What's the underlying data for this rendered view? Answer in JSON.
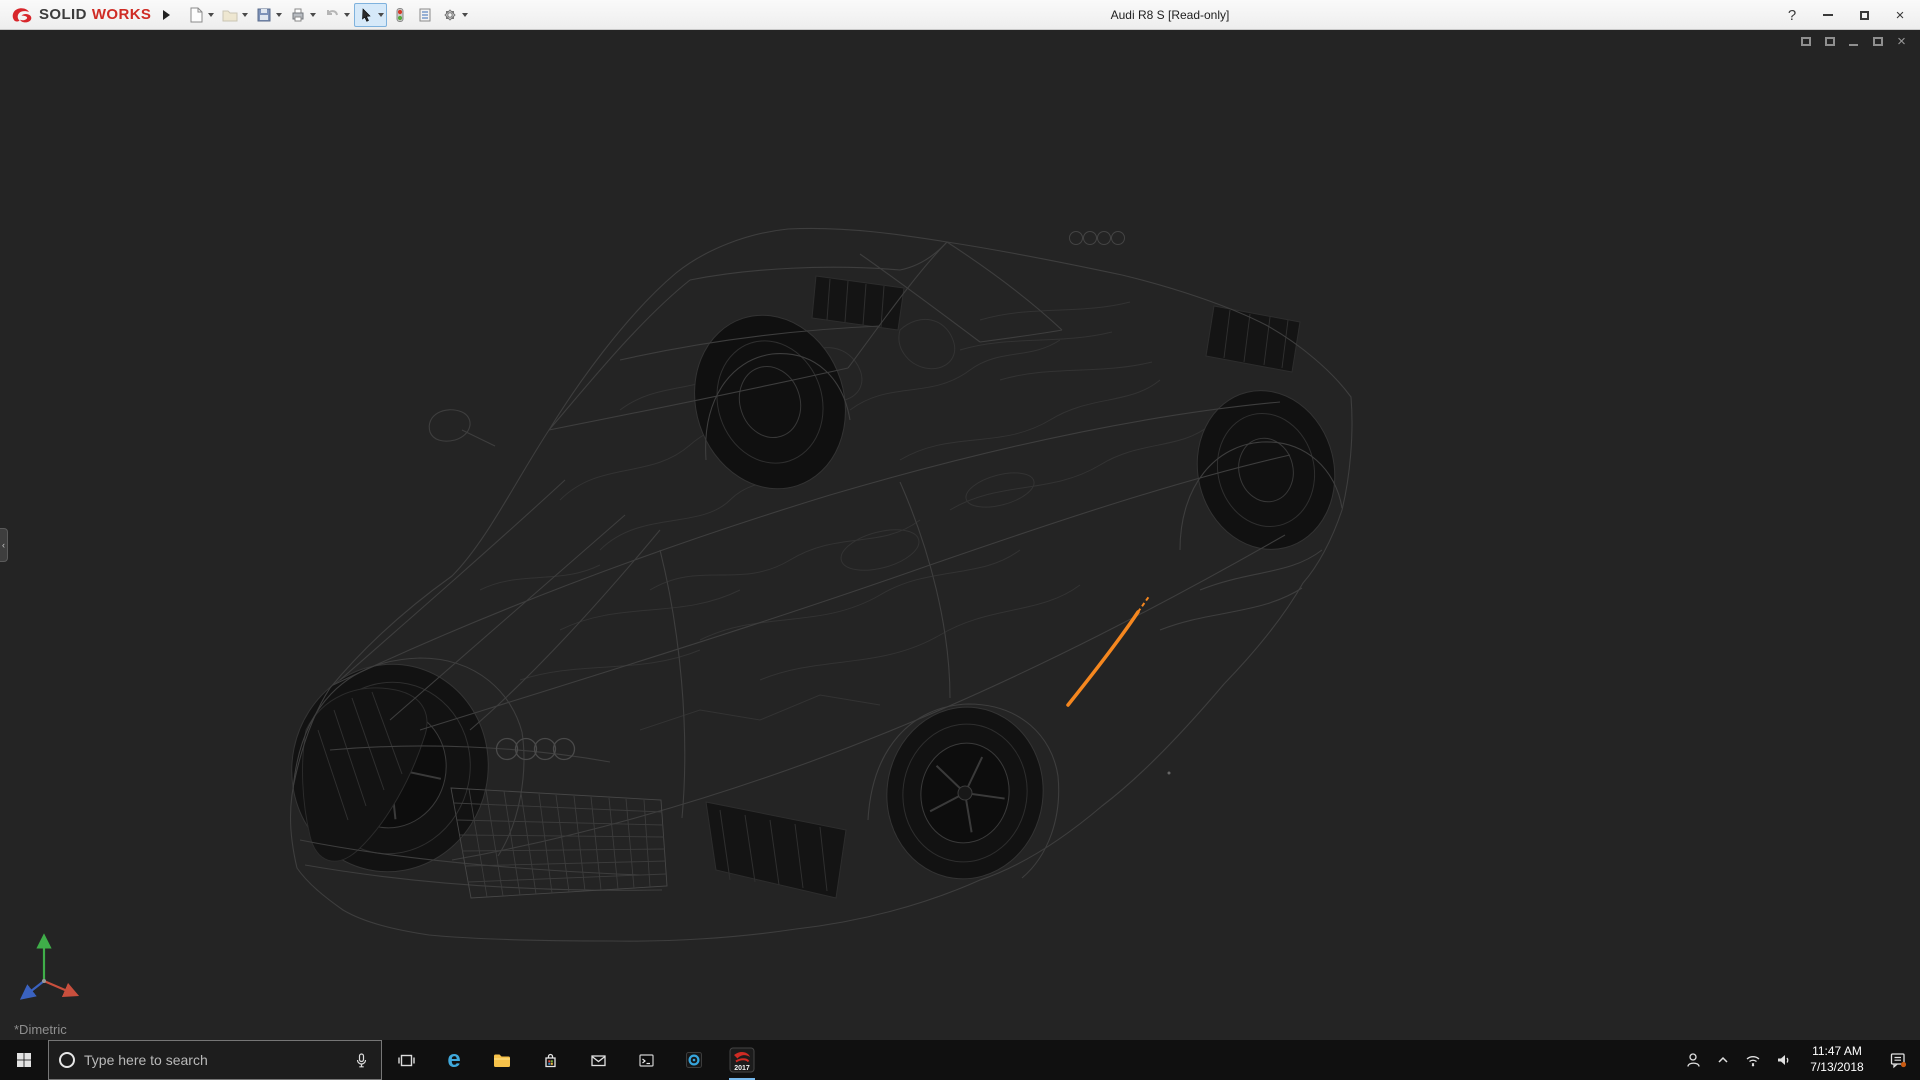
{
  "title_bar": {
    "brand": {
      "icon": "ds-swoosh-icon",
      "solid": "SOLID",
      "works": "WORKS"
    },
    "toolbar": {
      "items": [
        {
          "name": "New",
          "icon": "new-document-icon",
          "dropdown": true
        },
        {
          "name": "Open",
          "icon": "open-folder-icon",
          "dropdown": true
        },
        {
          "name": "Save",
          "icon": "save-icon",
          "dropdown": true
        },
        {
          "name": "Print",
          "icon": "print-icon",
          "dropdown": true
        },
        {
          "name": "Undo",
          "icon": "undo-icon",
          "dropdown": true
        },
        {
          "name": "Select",
          "icon": "select-cursor-icon",
          "dropdown": true,
          "active": true
        },
        {
          "name": "Rebuild",
          "icon": "rebuild-traffic-light-icon",
          "dropdown": false
        },
        {
          "name": "File Properties",
          "icon": "file-properties-icon",
          "dropdown": false
        },
        {
          "name": "Options",
          "icon": "options-gear-icon",
          "dropdown": true
        }
      ]
    },
    "document_title": "Audi R8 S [Read-only]",
    "window_controls": {
      "help": "?",
      "minimize": "minimize",
      "restore": "restore",
      "close_glyph": "×"
    }
  },
  "document_window_controls": {
    "buttons": [
      "pane",
      "pane",
      "minimize",
      "restore",
      "close"
    ]
  },
  "viewport": {
    "background_color": "#242424",
    "wireframe_line_color": "#3e3e3e",
    "selected_edge_color": "#f5871f",
    "model_name": "Audi R8 S wireframe",
    "view_orientation_label": "*Dimetric",
    "triad_axis_colors": {
      "x": "#c94f3d",
      "y": "#3fae49",
      "z": "#3a62c0"
    },
    "left_panel_handle_glyph": "‹"
  },
  "taskbar": {
    "start_icon": "windows-logo-icon",
    "search": {
      "placeholder": "Type here to search",
      "left_icon": "cortana-circle-icon",
      "right_icon": "microphone-icon"
    },
    "apps": [
      {
        "name": "task-view",
        "icon": "task-view-icon"
      },
      {
        "name": "edge",
        "icon": "edge-e-icon",
        "glyph": "e"
      },
      {
        "name": "file-explorer",
        "icon": "folder-icon"
      },
      {
        "name": "store",
        "icon": "shopping-bag-icon"
      },
      {
        "name": "mail",
        "icon": "envelope-icon"
      },
      {
        "name": "command-prompt",
        "icon": "console-icon"
      },
      {
        "name": "blue-circle-app",
        "icon": "blue-ring-icon"
      },
      {
        "name": "solidworks-2017",
        "icon": "solidworks-red-icon",
        "label": "2017",
        "active": true
      }
    ],
    "tray": {
      "icons": [
        "user-icon",
        "chevron-up-icon",
        "network-icon",
        "volume-icon"
      ],
      "clock": {
        "time": "11:47 AM",
        "date": "7/13/2018"
      },
      "action_center_icon": "action-center-icon"
    }
  }
}
